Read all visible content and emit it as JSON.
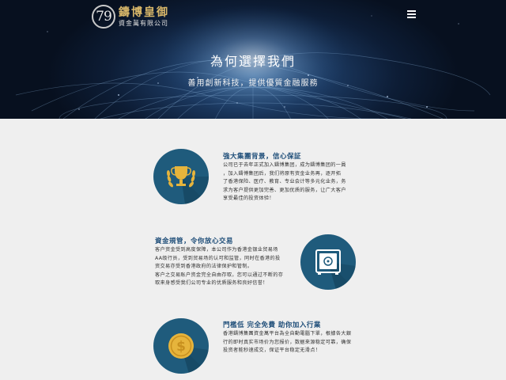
{
  "header": {
    "logo_number": "79",
    "brand_name": "鑄博皇御",
    "brand_sub": "資金萬有限公司",
    "menu_icon": "hamburger-menu-icon"
  },
  "hero": {
    "title": "為何選擇我們",
    "subtitle": "善用創新科技，提供優質金融服務"
  },
  "features": [
    {
      "icon": "trophy-icon",
      "title": "強大集團背景，信心保証",
      "lines": [
        "公司已于去年正式加入鑄博集团，成为鑄博集团的一員",
        "，加入鑄博集团后，我们将原有资金业务再，逐开拓",
        "了香港保险、医疗、教育、专业会计等多元化业务，务",
        "求为客户提供更加完善、更加优质的服务，让广大客户",
        "享受最佳的投资体验！"
      ]
    },
    {
      "icon": "safe-icon",
      "title": "資金規管，令你放心交易",
      "lines": [
        "客户资金受到高度保障，本公司作为香港金银业贸易场",
        "AA级行员，受到贸易场的认可和监管，同时在香港的投",
        "资交易亦受到香港政府的法律保护和管制。",
        "客户之交易账户资金完全自由存取，您可以通过不断的存",
        "取来身感受我们公司专业的优质服务和良好信誉！"
      ]
    },
    {
      "icon": "dollar-coin-icon",
      "title": "門檻低 完全免費 助你加入行業",
      "lines": [
        "香港鑄博集團資金萬平台為全自動電腦下單，根據各大銀",
        "行的即时真实市场价为您报价，数据来源稳定可靠，确保",
        "投资者能秒速成交，保证平台稳定无滑点！"
      ]
    }
  ],
  "colors": {
    "accent_title": "#1f4e79",
    "icon_circle": "#1f5b7c",
    "gold": "#e6b43c",
    "hero_dark": "#07101f"
  }
}
